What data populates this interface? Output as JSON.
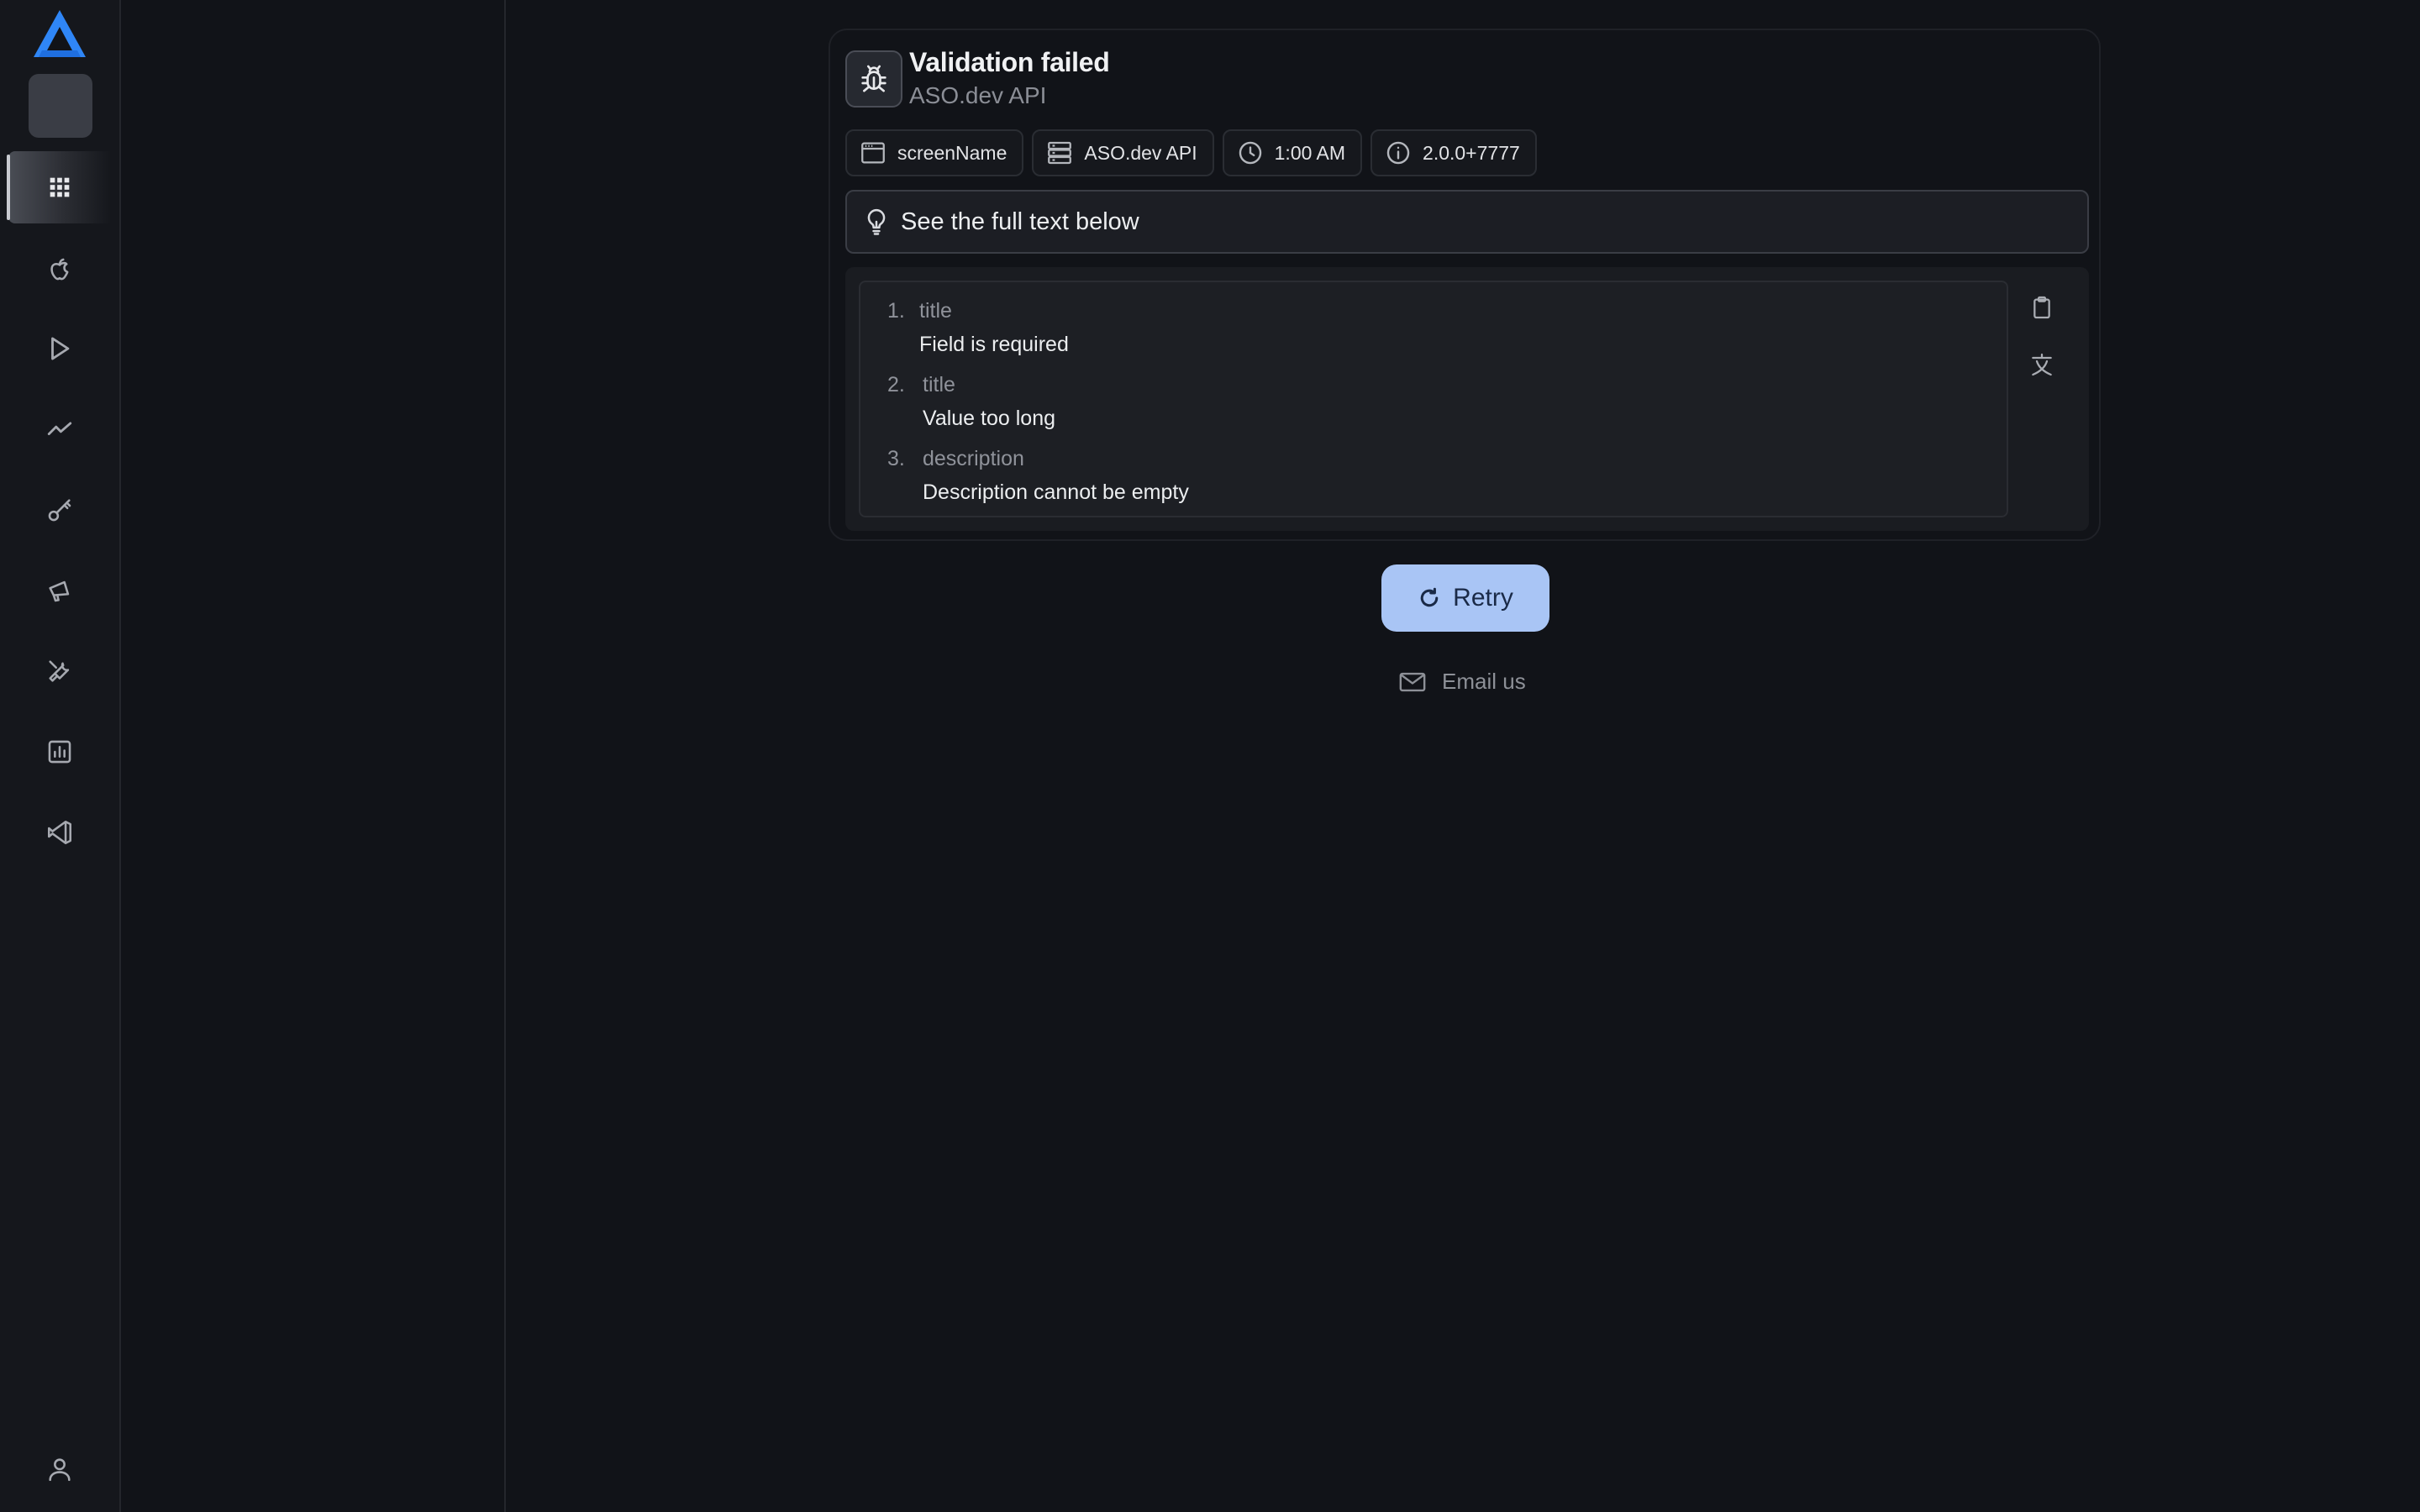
{
  "sidebar": {
    "items": [
      {
        "name": "apps",
        "icon": "grid-icon",
        "active": true
      },
      {
        "name": "app-store",
        "icon": "apple-icon"
      },
      {
        "name": "google-play",
        "icon": "play-icon"
      },
      {
        "name": "trends",
        "icon": "trend-icon"
      },
      {
        "name": "keywords",
        "icon": "key-icon"
      },
      {
        "name": "campaigns",
        "icon": "megaphone-icon"
      },
      {
        "name": "tools",
        "icon": "wrench-icon"
      },
      {
        "name": "reports",
        "icon": "bar-chart-icon"
      },
      {
        "name": "vscode",
        "icon": "code-editor-icon"
      }
    ],
    "profile_icon": "user-icon"
  },
  "error": {
    "title": "Validation failed",
    "source": "ASO.dev API",
    "chips": [
      {
        "icon": "window-icon",
        "label": "screenName"
      },
      {
        "icon": "server-icon",
        "label": "ASO.dev API"
      },
      {
        "icon": "clock-icon",
        "label": "1:00 AM"
      },
      {
        "icon": "info-icon",
        "label": "2.0.0+7777"
      }
    ],
    "hint": "See the full text below",
    "items": [
      {
        "num": "1.",
        "field": "title",
        "message": "Field is required"
      },
      {
        "num": "2.",
        "field": "title",
        "message": "Value too long"
      },
      {
        "num": "3.",
        "field": "description",
        "message": "Description cannot be empty"
      }
    ]
  },
  "actions": {
    "retry_label": "Retry",
    "email_label": "Email us"
  },
  "colors": {
    "background": "#111318",
    "accent": "#a9c5f5",
    "logo": "#2f86f6"
  }
}
